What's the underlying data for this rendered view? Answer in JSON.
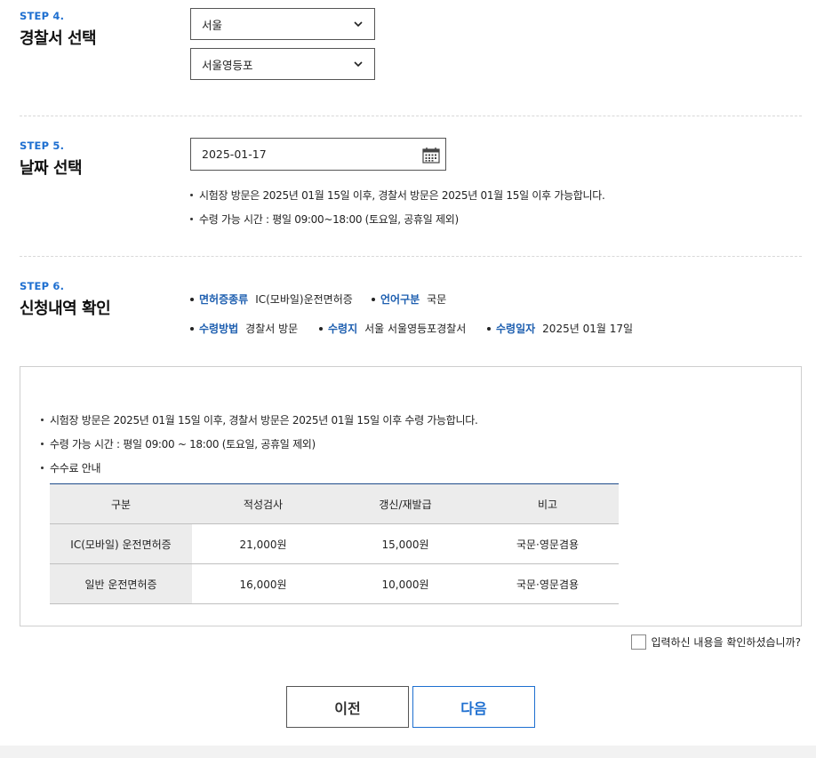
{
  "step4": {
    "label": "STEP 4.",
    "title": "경찰서 선택",
    "region_select": "서울",
    "station_select": "서울영등포"
  },
  "step5": {
    "label": "STEP 5.",
    "title": "날짜 선택",
    "date_value": "2025-01-17",
    "notes": [
      "시험장 방문은 2025년 01월 15일 이후, 경찰서 방문은 2025년 01월 15일 이후 가능합니다.",
      "수령 가능 시간 : 평일 09:00~18:00 (토요일, 공휴일 제외)"
    ]
  },
  "step6": {
    "label": "STEP 6.",
    "title": "신청내역 확인",
    "fields": [
      {
        "key": "면허증종류",
        "value": "IC(모바일)운전면허증"
      },
      {
        "key": "언어구분",
        "value": "국문"
      },
      {
        "key": "수령방법",
        "value": "경찰서 방문"
      },
      {
        "key": "수령지",
        "value": "서울 서울영등포경찰서"
      },
      {
        "key": "수령일자",
        "value": "2025년 01월 17일"
      }
    ]
  },
  "info": {
    "notes": [
      "시험장 방문은 2025년 01월 15일 이후, 경찰서 방문은 2025년 01월 15일 이후 수령 가능합니다.",
      "수령 가능 시간 : 평일 09:00 ~ 18:00 (토요일, 공휴일 제외)",
      "수수료 안내"
    ],
    "table": {
      "headers": [
        "구분",
        "적성검사",
        "갱신/재발급",
        "비고"
      ],
      "rows": [
        [
          "IC(모바일) 운전면허증",
          "21,000원",
          "15,000원",
          "국문·영문겸용"
        ],
        [
          "일반 운전면허증",
          "16,000원",
          "10,000원",
          "국문·영문겸용"
        ]
      ]
    }
  },
  "confirm_label": "입력하신 내용을 확인하셨습니까?",
  "buttons": {
    "prev": "이전",
    "next": "다음"
  },
  "colors": {
    "accent": "#1e6fd0",
    "label_blue": "#1e5fb0",
    "table_header_border": "#1e4b8a"
  },
  "icons": [
    "chevron-down-icon",
    "calendar-icon"
  ]
}
